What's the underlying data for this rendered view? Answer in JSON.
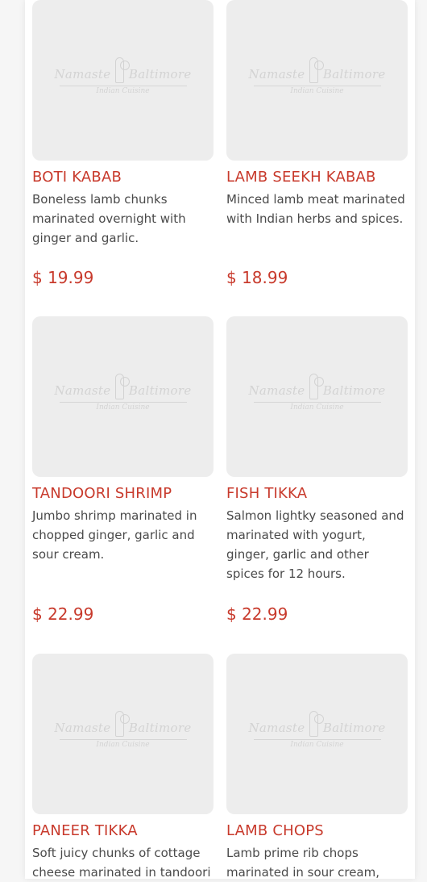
{
  "logo": {
    "brand_left": "Namaste",
    "brand_right": "Baltimore",
    "subtitle": "Indian Cuisine"
  },
  "items": [
    {
      "title": "BOTI KABAB",
      "description": "Boneless lamb chunks marinated overnight with ginger and garlic.",
      "price": "$ 19.99"
    },
    {
      "title": "LAMB SEEKH KABAB",
      "description": "Minced lamb meat marinated with Indian herbs and spices.",
      "price": "$ 18.99"
    },
    {
      "title": "TANDOORI SHRIMP",
      "description": "Jumbo shrimp marinated in chopped ginger, garlic and sour cream.",
      "price": "$ 22.99"
    },
    {
      "title": "FISH TIKKA",
      "description": "Salmon lightky seasoned and marinated with yogurt, ginger, garlic and other spices for 12 hours.",
      "price": "$ 22.99"
    },
    {
      "title": "PANEER TIKKA",
      "description": "Soft juicy chunks of cottage cheese marinated in tandoori",
      "price": ""
    },
    {
      "title": "LAMB CHOPS",
      "description": "Lamb prime rib chops marinated in sour cream,",
      "price": ""
    }
  ],
  "colors": {
    "accent": "#c83a2c",
    "text": "#4a4a4a",
    "thumb_bg": "#ededed"
  }
}
